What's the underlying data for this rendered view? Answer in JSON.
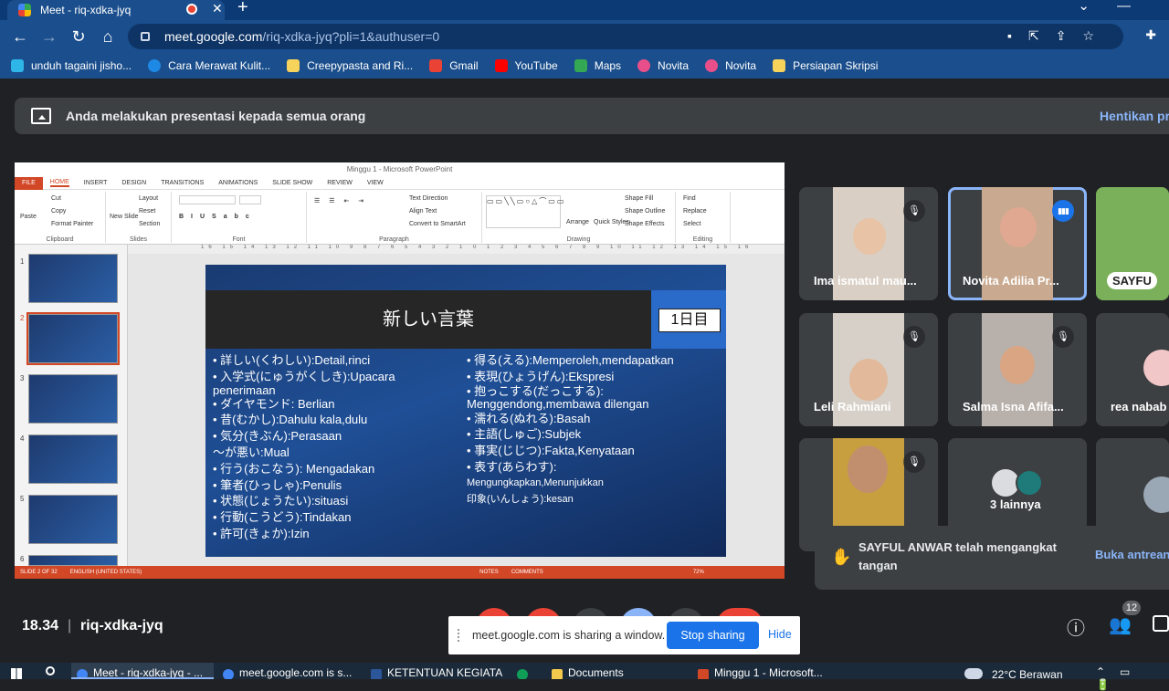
{
  "browser": {
    "tab_title": "Meet - riq-xdka-jyq",
    "url_host": "meet.google.com",
    "url_path": "/riq-xdka-jyq?pli=1&authuser=0",
    "bookmarks": [
      {
        "label": "unduh tagaini jisho...",
        "color": "#2fb6e8"
      },
      {
        "label": "Cara Merawat Kulit...",
        "color": "#1e88e5"
      },
      {
        "label": "Creepypasta and Ri...",
        "color": "#f6d35b"
      },
      {
        "label": "Gmail",
        "color": "#ea4335"
      },
      {
        "label": "YouTube",
        "color": "#ff0000"
      },
      {
        "label": "Maps",
        "color": "#34a853"
      },
      {
        "label": "Novita",
        "color": "#e84e89"
      },
      {
        "label": "Novita",
        "color": "#e84e89"
      },
      {
        "label": "Persiapan Skripsi",
        "color": "#f6d35b"
      }
    ]
  },
  "banner": {
    "text": "Anda melakukan presentasi kepada semua orang",
    "stop": "Hentikan pr"
  },
  "ppt": {
    "title": "Minggu 1 - Microsoft PowerPoint",
    "tabs": [
      "FILE",
      "HOME",
      "INSERT",
      "DESIGN",
      "TRANSITIONS",
      "ANIMATIONS",
      "SLIDE SHOW",
      "REVIEW",
      "VIEW"
    ],
    "groups": {
      "clipboard": "Clipboard",
      "slides": "Slides",
      "font": "Font",
      "paragraph": "Paragraph",
      "drawing": "Drawing",
      "editing": "Editing"
    },
    "ribbon_items": {
      "paste": "Paste",
      "cut": "Cut",
      "copy": "Copy",
      "format_painter": "Format Painter",
      "new_slide": "New Slide",
      "layout": "Layout",
      "reset": "Reset",
      "section": "Section",
      "text_direction": "Text Direction",
      "align_text": "Align Text",
      "convert_smartart": "Convert to SmartArt",
      "arrange": "Arrange",
      "quick_styles": "Quick Styles",
      "shape_fill": "Shape Fill",
      "shape_outline": "Shape Outline",
      "shape_effects": "Shape Effects",
      "find": "Find",
      "replace": "Replace",
      "select": "Select"
    },
    "ruler": "16 15 14 13 12 11 10 9 8 7 6 5 4 3 2 1 0 1 2 3 4 5 6 7 8 9 10 11 12 13 14 15 16",
    "thumb_numbers": [
      "1",
      "2",
      "3",
      "4",
      "5",
      "6"
    ],
    "status": {
      "slide": "SLIDE 2 OF 32",
      "lang": "ENGLISH (UNITED STATES)",
      "notes": "NOTES",
      "comments": "COMMENTS",
      "zoom": "72%"
    },
    "slide": {
      "heading": "新しい言葉",
      "day": "1日目",
      "left": [
        "• 詳しい(くわしい):Detail,rinci",
        "• 入学式(にゅうがくしき):Upacara",
        "   penerimaan",
        "• ダイヤモンド: Berlian",
        "• 昔(むかし):Dahulu kala,dulu",
        "• 気分(きぶん):Perasaan",
        "～が悪い:Mual",
        "• 行う(おこなう): Mengadakan",
        "• 筆者(ひっしゃ):Penulis",
        "• 状態(じょうたい):situasi",
        "• 行動(こうどう):Tindakan",
        "• 許可(きょか):Izin"
      ],
      "right": [
        "• 得る(える):Memperoleh,mendapatkan",
        "• 表現(ひょうげん):Ekspresi",
        "• 抱っこする(だっこする):",
        "   Menggendong,membawa dilengan",
        "• 濡れる(ぬれる):Basah",
        "• 主語(しゅご):Subjek",
        "• 事実(じじつ):Fakta,Kenyataan",
        "• 表す(あらわす):"
      ],
      "right_small": [
        "Mengungkapkan,Menunjukkan",
        "印象(いんしょう):kesan"
      ]
    }
  },
  "participants": [
    {
      "name": "Ima ismatul mau...",
      "muted": true
    },
    {
      "name": "Novita Adilia Pr...",
      "muted": false,
      "speaking": true
    },
    {
      "name": "SAYFU",
      "muted": false
    },
    {
      "name": "Leli Rahmiani",
      "muted": true
    },
    {
      "name": "Salma Isna Afifa...",
      "muted": true
    },
    {
      "name": "rea nabab",
      "muted": false
    },
    {
      "name": "",
      "muted": true
    },
    {
      "name": "3 lainnya",
      "muted": false
    },
    {
      "name": "",
      "muted": false
    }
  ],
  "toast": {
    "message": "SAYFUL ANWAR telah mengangkat tangan",
    "action": "Buka antrean"
  },
  "meeting": {
    "time": "18.34",
    "separator": "|",
    "code": "riq-xdka-jyq",
    "participant_count": "12"
  },
  "share_bar": {
    "text": "meet.google.com is sharing a window.",
    "stop": "Stop sharing",
    "hide": "Hide"
  },
  "taskbar": {
    "items": [
      {
        "label": "Meet - riq-xdka-jyq - ...",
        "color": "#4285f4"
      },
      {
        "label": "meet.google.com is s...",
        "color": "#4285f4"
      },
      {
        "label": "KETENTUAN KEGIATA...",
        "color": "#2b579a"
      },
      {
        "label": "",
        "color": "#0f9d58"
      },
      {
        "label": "Documents",
        "color": "#f2c94c"
      },
      {
        "label": "Minggu 1 - Microsoft...",
        "color": "#d24726"
      }
    ],
    "weather": "22°C  Berawan"
  }
}
